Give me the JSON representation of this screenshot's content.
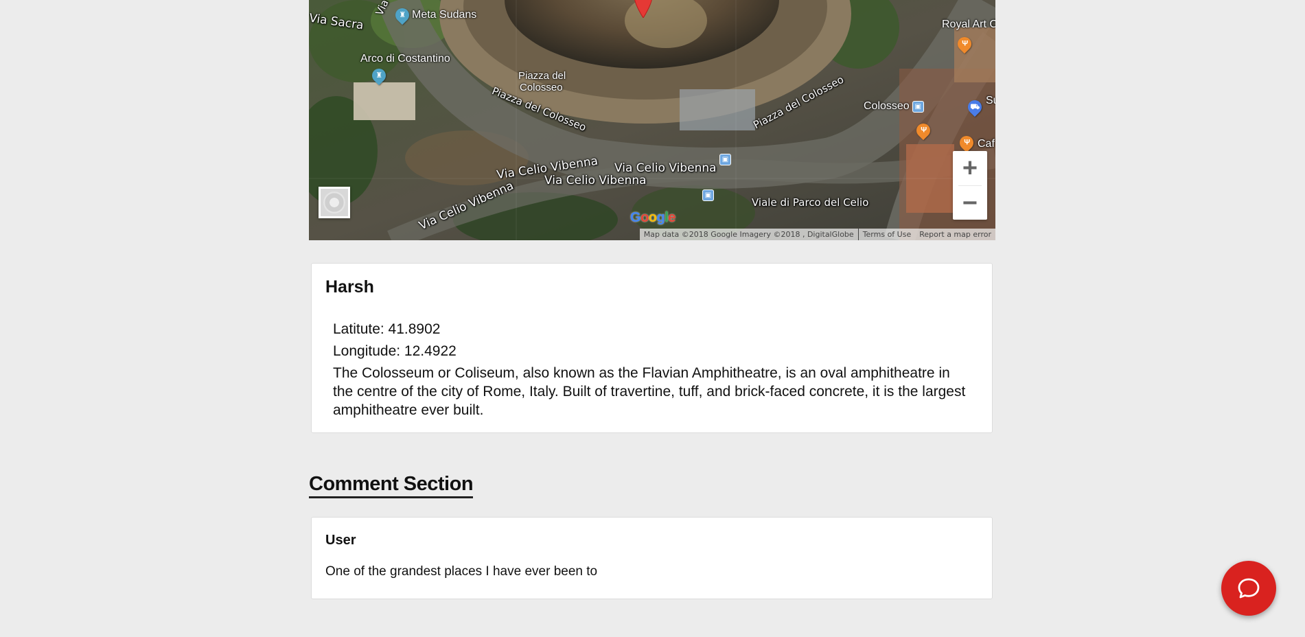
{
  "map": {
    "streets": [
      "Via Sacra",
      "Via Celio Vibenna",
      "Via Celio Vibenna",
      "Via Celio Vibenna",
      "Via Celio Vibenna",
      "Piazza del Colosseo",
      "Piazza del Colosseo",
      "Viale di Parco del Celio",
      "Via"
    ],
    "pois": {
      "meta_sudans": "Meta Sudans",
      "arco": "Arco di Costantino",
      "piazza_line1": "Piazza del",
      "piazza_line2": "Colosseo",
      "colosseo": "Colosseo",
      "royal_art": "Royal Art C",
      "cafe": "Caf",
      "su": "Su"
    },
    "zoom_in_label": "+",
    "zoom_out_label": "−",
    "google_logo": "Google",
    "attribution": {
      "data": "Map data ©2018 Google Imagery ©2018 , DigitalGlobe",
      "terms": "Terms of Use",
      "report": "Report a map error"
    },
    "icons": {
      "marker": "map-marker-icon",
      "monument": "monument-icon",
      "restaurant": "restaurant-icon",
      "shopping": "shopping-cart-icon",
      "transit": "bus-stop-icon"
    },
    "colors": {
      "marker": "#e53935",
      "poi_monument": "#4fa3c7",
      "poi_food": "#f08a2b",
      "poi_shop": "#4a7de8"
    }
  },
  "place": {
    "name": "Harsh",
    "latitude": "Latitute: 41.8902",
    "longitude": "Longitude: 12.4922",
    "description": "The Colosseum or Coliseum, also known as the Flavian Amphitheatre, is an oval amphitheatre in the centre of the city of Rome, Italy. Built of travertine, tuff, and brick-faced concrete, it is the largest amphitheatre ever built."
  },
  "comments": {
    "section_title": "Comment Section",
    "items": [
      {
        "user": "User",
        "text": "One of the grandest places I have ever been to"
      }
    ]
  },
  "chat": {
    "icon": "chat-bubble-icon",
    "color": "#d9221f"
  }
}
